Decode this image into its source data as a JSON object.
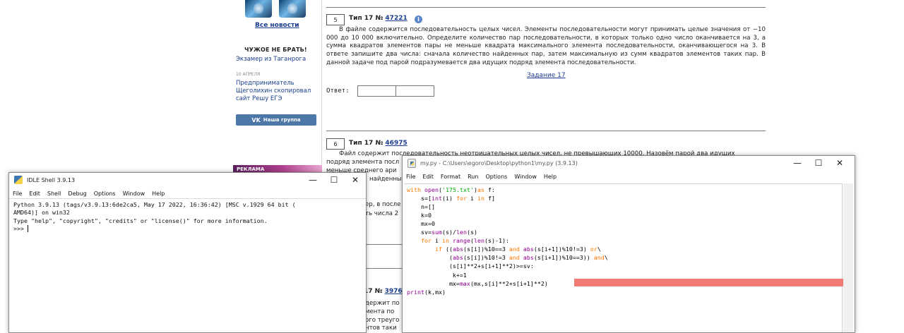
{
  "webpage": {
    "sidebar": {
      "all_news": "Все новости",
      "dont_copy_title": "ЧУЖОЕ НЕ БРАТЬ!",
      "exam_link": "Экзамер из Таганрога",
      "news_date": "10 АПРЕЛЯ",
      "news_text": "Предприниматель Щеголихин скопировал сайт Решу ЕГЭ",
      "vk_button": "Наша группа",
      "ad_label": "РЕКЛАМА"
    },
    "task5": {
      "number": "5",
      "type_label": "Тип 17 № ",
      "id": "47221",
      "text": "В файле содержится последовательность целых чисел. Элементы последовательности могут принимать целые значения от −10 000 до 10 000 включительно. Определите количество пар последовательности, в которых только одно число оканчивается на 3, а сумма квадратов элементов пары не меньше квадрата максимального элемента последовательности, оканчивающегося на 3. В ответе запишите два числа: сначала количество найденных пар, затем максимальную из сумм квадратов элементов таких пар. В данной задаче под парой подразумевается два идущих подряд элемента последовательности.",
      "link": "Задание 17",
      "answer_label": "Ответ:"
    },
    "task6": {
      "number": "6",
      "type_label": "Тип 17 № ",
      "id": "46975",
      "line1": "Файл содержит последовательность неотрицательных целых чисел, не превышающих 10000. Назовём парой два идущих",
      "line2": "подряд элемента посл",
      "line3": "меньше среднего ари",
      "line4": "найденных",
      "frag_a": "ер, в после",
      "frag_b": "ть числа 2"
    },
    "task8": {
      "head": "17 № ",
      "id": "3976",
      "frag1": "держит по",
      "frag2": "мента по",
      "frag3": "ого треуго",
      "frag4": "нтов таки"
    }
  },
  "shell_window": {
    "title": "IDLE Shell 3.9.13",
    "menu": [
      "File",
      "Edit",
      "Shell",
      "Debug",
      "Options",
      "Window",
      "Help"
    ],
    "lines": [
      "Python 3.9.13 (tags/v3.9.13:6de2ca5, May 17 2022, 16:36:42) [MSC v.1929 64 bit (",
      "AMD64)] on win32",
      "Type \"help\", \"copyright\", \"credits\" or \"license()\" for more information."
    ],
    "prompt": ">>> "
  },
  "editor_window": {
    "title": "my.py - C:\\Users\\egoro\\Desktop\\python1\\my.py (3.9.13)",
    "menu": [
      "File",
      "Edit",
      "Format",
      "Run",
      "Options",
      "Window",
      "Help"
    ],
    "code_lines": [
      "with open('175.txt')as f:",
      "    s=[int(i) for i in f]",
      "    n=[]",
      "    k=0",
      "    mx=0",
      "    sv=sum(s)/len(s)",
      "    for i in range(len(s)-1):",
      "        if ((abs(s[i])%10==3 and abs(s[i+1])%10!=3) or\\",
      "            (abs(s[i])%10!=3 and abs(s[i+1])%10==3)) and\\",
      "            (s[i]**2+s[i+1]**2)>=sv:",
      "             k+=1",
      "            mx=max(mx,s[i]**2+s[i+1]**2)",
      "print(k,mx)"
    ],
    "error_highlight_color": "#f27a74"
  },
  "icons": {
    "minimize": "minimize-icon",
    "maximize": "maximize-icon",
    "close": "close-icon",
    "info": "info-icon",
    "vk": "vk-icon",
    "python_app": "python-icon"
  }
}
